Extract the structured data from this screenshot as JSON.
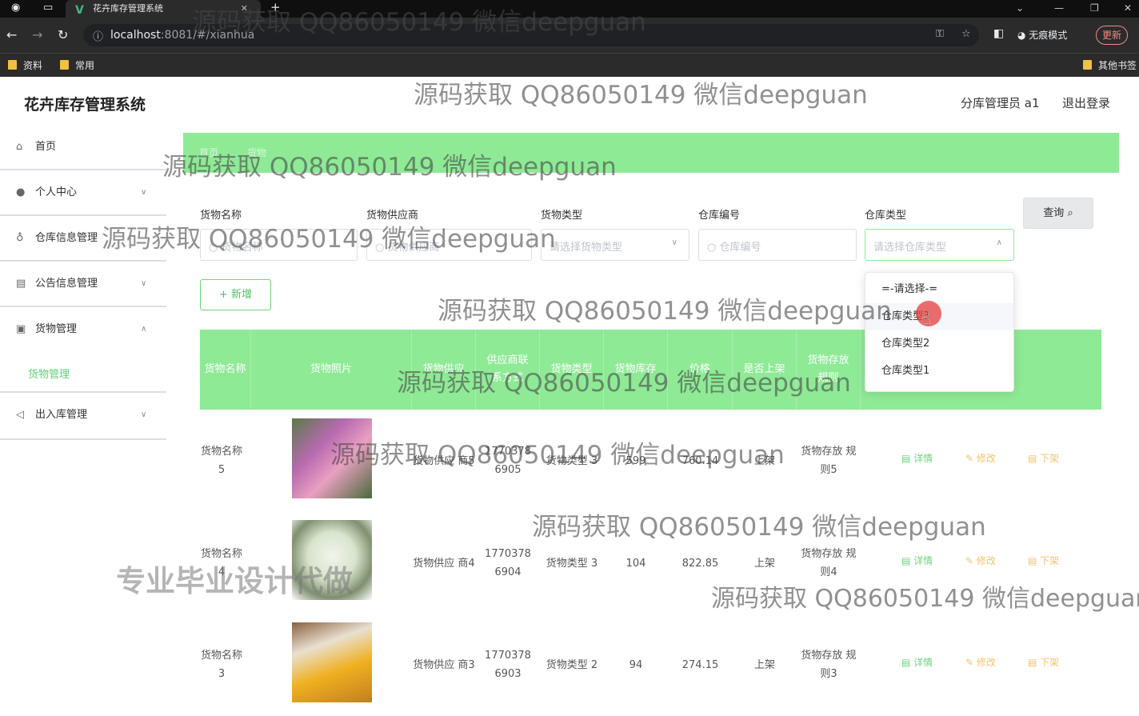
{
  "browser": {
    "tab_title": "花卉库存管理系统",
    "url_host": "localhost",
    "url_rest": ":8081/#/xianhua",
    "incognito_label": "无痕模式",
    "update_label": "更新",
    "bookmarks": [
      "资料",
      "常用"
    ],
    "other_bookmarks": "其他书签"
  },
  "header": {
    "brand": "花卉库存管理系统",
    "user": "分库管理员 a1",
    "logout": "退出登录"
  },
  "sidebar": {
    "items": [
      {
        "icon": "home-icon",
        "label": "首页"
      },
      {
        "icon": "user-icon",
        "label": "个人中心"
      },
      {
        "icon": "mic-icon",
        "label": "仓库信息管理"
      },
      {
        "icon": "notice-icon",
        "label": "公告信息管理"
      },
      {
        "icon": "trash-icon",
        "label": "货物管理"
      },
      {
        "icon": "send-icon",
        "label": "出入库管理"
      }
    ],
    "subitem": "货物管理"
  },
  "breadcrumb": {
    "home": "首页",
    "current": "货物"
  },
  "filters": [
    {
      "label": "货物名称",
      "placeholder": "货物名称"
    },
    {
      "label": "货物供应商",
      "placeholder": "货物供应商"
    },
    {
      "label": "货物类型",
      "placeholder": "请选择货物类型"
    },
    {
      "label": "仓库编号",
      "placeholder": "仓库编号"
    },
    {
      "label": "仓库类型",
      "placeholder": "请选择仓库类型"
    }
  ],
  "query_label": "查询",
  "add_label": "+ 新增",
  "table": {
    "headers": [
      "货物名称",
      "货物照片",
      "货物供应",
      "供应商联系方式",
      "货物类型",
      "货物库存",
      "价格",
      "是否上架",
      "货物存放规则"
    ],
    "rows": [
      {
        "name": "货物名称 5",
        "supplier": "货物供应 商5",
        "phone": "1770378 6905",
        "type": "货物类型 3",
        "stock": "599",
        "price": "760.14",
        "status": "上架",
        "rule": "货物存放 规则5",
        "photo_colors": [
          "#b86ab0",
          "#e8a0c0",
          "#5a7a4a"
        ]
      },
      {
        "name": "货物名称 4",
        "supplier": "货物供应 商4",
        "phone": "1770378 6904",
        "type": "货物类型 3",
        "stock": "104",
        "price": "822.85",
        "status": "上架",
        "rule": "货物存放 规则4",
        "photo_colors": [
          "#eef0ea",
          "#a8c09a",
          "#6d7a60"
        ]
      },
      {
        "name": "货物名称 3",
        "supplier": "货物供应 商3",
        "phone": "1770378 6903",
        "type": "货物类型 2",
        "stock": "94",
        "price": "274.15",
        "status": "上架",
        "rule": "货物存放 规则3",
        "photo_colors": [
          "#f0b020",
          "#e8e0d0",
          "#8a6040"
        ]
      }
    ],
    "actions": {
      "detail": "详情",
      "edit": "修改",
      "offline": "下架"
    }
  },
  "dropdown": {
    "options": [
      "=-请选择-=",
      "仓库类型3",
      "仓库类型2",
      "仓库类型1"
    ],
    "hovered_index": 1
  },
  "watermarks": {
    "text": "源码获取 QQ86050149 微信deepguan",
    "bold_text": "专业毕业设计代做"
  },
  "colors": {
    "accent_green": "#8fea96",
    "link_green": "#5fcf77",
    "warn": "#f5c36b"
  }
}
